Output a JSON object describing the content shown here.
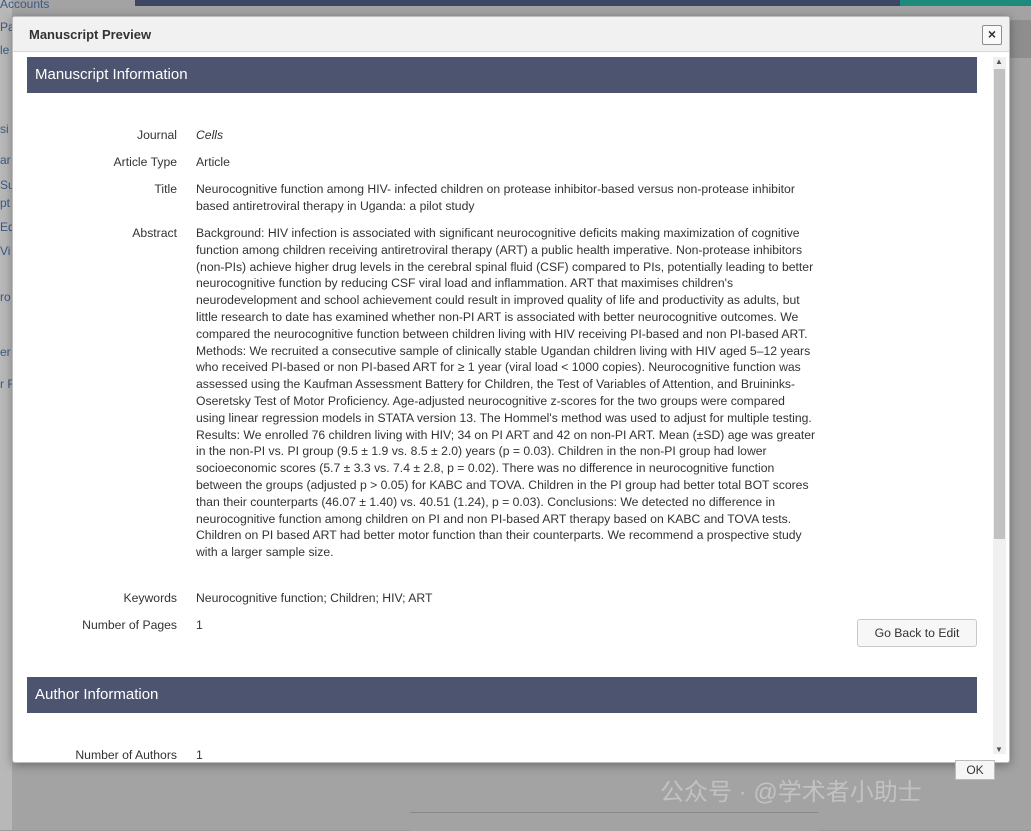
{
  "background": {
    "left_fragments": [
      "Accounts",
      "Pa",
      "le",
      "si",
      "ar",
      "Su",
      "pt",
      "Edi",
      "Vi",
      "ro",
      "er",
      "r F"
    ]
  },
  "modal": {
    "title": "Manuscript Preview",
    "close_label": "×",
    "footer_button_label": "OK"
  },
  "manuscript_info": {
    "header": "Manuscript Information",
    "fields": [
      {
        "label": "Journal",
        "value": "Cells"
      },
      {
        "label": "Article Type",
        "value": "Article"
      },
      {
        "label": "Title",
        "value": "Neurocognitive function among HIV- infected children on protease inhibitor-based versus non-protease inhibitor based antiretroviral therapy in Uganda: a pilot study"
      },
      {
        "label": "Abstract",
        "value": "Background: HIV infection is associated with significant neurocognitive deficits making maximization of cognitive function among children receiving antiretroviral therapy (ART) a public health imperative. Non-protease inhibitors (non-PIs) achieve higher drug levels in the cerebral spinal fluid (CSF) compared to PIs, potentially leading to better neurocognitive function by reducing CSF viral load and inflammation. ART that maximises children's neurodevelopment and school achievement could result in improved quality of life and productivity as adults, but little research to date has examined whether non-PI ART is associated with better neurocognitive outcomes. We compared the neurocognitive function between children living with HIV receiving PI-based and non PI-based ART. Methods: We recruited a consecutive sample of clinically stable Ugandan children living with HIV aged 5–12 years who received PI-based or non PI-based ART for ≥ 1 year (viral load < 1000 copies). Neurocognitive function was assessed using the Kaufman Assessment Battery for Children, the Test of Variables of Attention, and Bruininks- Oseretsky Test of Motor Proficiency. Age-adjusted neurocognitive z-scores for the two groups were compared using linear regression models in STATA version 13. The Hommel's method was used to adjust for multiple testing. Results: We enrolled 76 children living with HIV; 34 on PI ART and 42 on non-PI ART. Mean (±SD) age was greater in the non-PI vs. PI group (9.5 ± 1.9 vs. 8.5 ± 2.0) years (p = 0.03). Children in the non-PI group had lower socioeconomic scores (5.7 ± 3.3 vs. 7.4 ± 2.8, p = 0.02). There was no difference in neurocognitive function between the groups (adjusted p > 0.05) for KABC and TOVA. Children in the PI group had better total BOT scores than their counterparts (46.07 ± 1.40) vs. 40.51 (1.24), p = 0.03). Conclusions: We detected no difference in neurocognitive function among children on PI and non PI-based ART therapy based on KABC and TOVA tests. Children on PI based ART had better motor function than their counterparts. We recommend a prospective study with a larger sample size."
      },
      {
        "label": "Keywords",
        "value": "Neurocognitive function; Children; HIV; ART"
      },
      {
        "label": "Number of Pages",
        "value": "1"
      }
    ],
    "go_back_label": "Go Back to Edit"
  },
  "author_info": {
    "header": "Author Information",
    "fields": [
      {
        "label": "Number of Authors",
        "value": "1"
      }
    ]
  },
  "watermark": "公众号 · @学术者小助士"
}
